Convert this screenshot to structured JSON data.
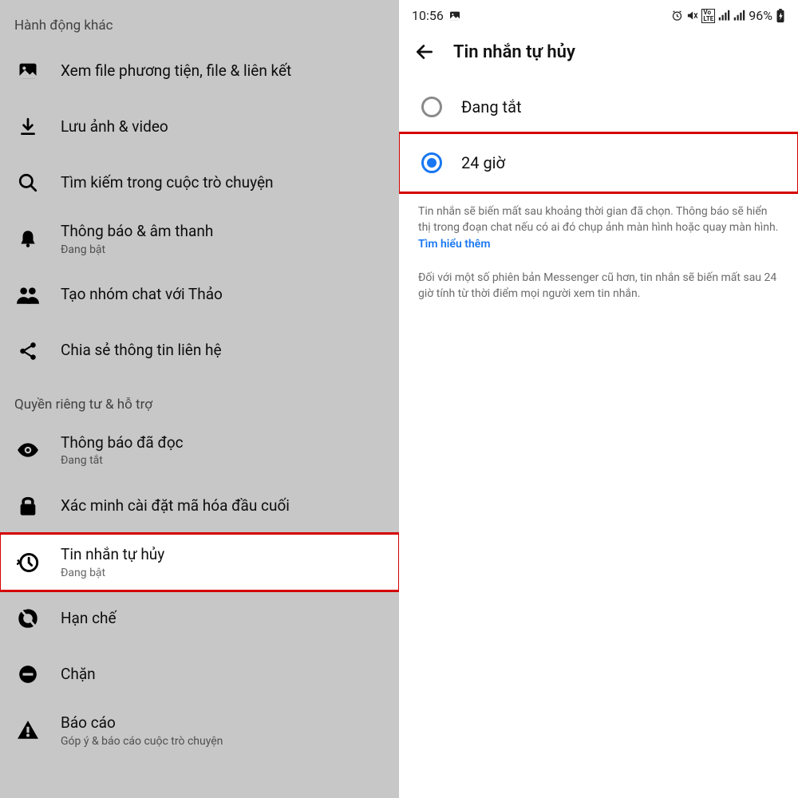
{
  "left": {
    "section1_header": "Hành động khác",
    "items1": [
      {
        "title": "Xem file phương tiện, file & liên kết"
      },
      {
        "title": "Lưu ảnh & video"
      },
      {
        "title": "Tìm kiếm trong cuộc trò chuyện"
      },
      {
        "title": "Thông báo & âm thanh",
        "sub": "Đang bật"
      },
      {
        "title": "Tạo nhóm chat với Thảo"
      },
      {
        "title": "Chia sẻ thông tin liên hệ"
      }
    ],
    "section2_header": "Quyền riêng tư & hỗ trợ",
    "items2": [
      {
        "title": "Thông báo đã đọc",
        "sub": "Đang tắt"
      },
      {
        "title": "Xác minh cài đặt mã hóa đầu cuối"
      },
      {
        "title": "Tin nhắn tự hủy",
        "sub": "Đang bật"
      },
      {
        "title": "Hạn chế"
      },
      {
        "title": "Chặn"
      },
      {
        "title": "Báo cáo",
        "sub": "Góp ý & báo cáo cuộc trò chuyện"
      }
    ]
  },
  "right": {
    "status_time": "10:56",
    "status_battery": "96%",
    "header_title": "Tin nhắn tự hủy",
    "option_off": "Đang tắt",
    "option_24h": "24 giờ",
    "desc_main": "Tin nhắn sẽ biến mất sau khoảng thời gian đã chọn. Thông báo sẽ hiển thị trong đoạn chat nếu có ai đó chụp ảnh màn hình hoặc quay màn hình. ",
    "desc_link": "Tìm hiểu thêm",
    "desc_note": "Đối với một số phiên bản Messenger cũ hơn, tin nhắn sẽ biến mất sau 24 giờ tính từ thời điểm mọi người xem tin nhắn."
  }
}
